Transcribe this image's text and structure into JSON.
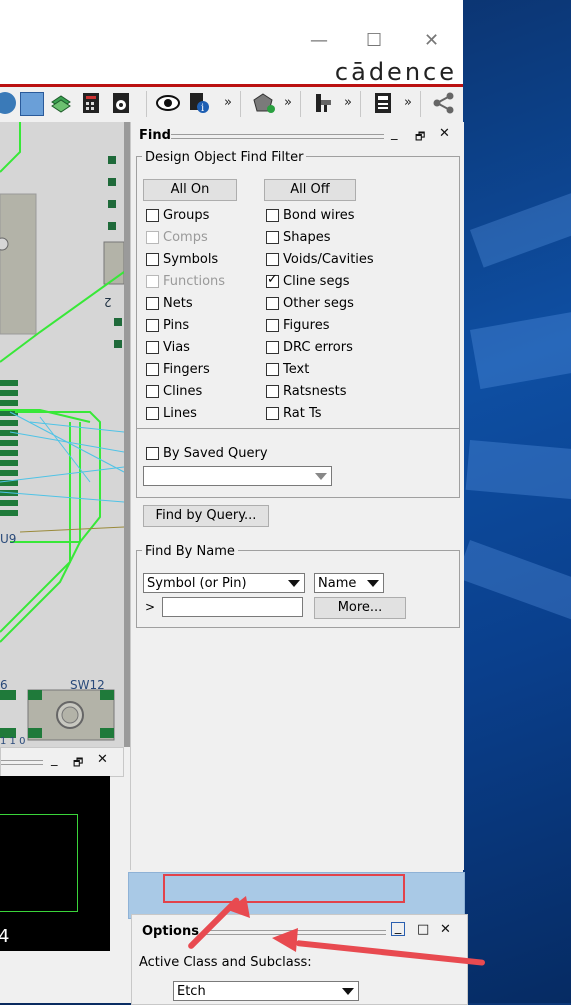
{
  "window": {
    "brand": "cādence",
    "controls": {
      "minimize": "—",
      "maximize": "☐",
      "close": "✕"
    }
  },
  "toolbar": {
    "icons": [
      "view-icon",
      "layers-icon",
      "stack-icon",
      "calc-icon",
      "gear-doc-icon",
      "eye-icon",
      "info-icon",
      "pentagon-icon",
      "probe-icon",
      "memory-icon",
      "share-icon"
    ],
    "overflow": "»"
  },
  "canvas": {
    "labels": {
      "sw_left": "2",
      "u9": "U9",
      "sw6": "6",
      "sw12": "SW12",
      "bottom": "1 1 0"
    }
  },
  "worldview": {
    "controls": {
      "minimize": "_",
      "restore": "🗗",
      "close": "✕"
    },
    "number": "4"
  },
  "find": {
    "title": "Find",
    "controls": {
      "minimize": "_",
      "restore": "🗗",
      "close": "✕"
    },
    "filter_group": "Design Object Find Filter",
    "all_on": "All On",
    "all_off": "All Off",
    "left_items": [
      {
        "label": "Groups",
        "checked": false,
        "enabled": true
      },
      {
        "label": "Comps",
        "checked": false,
        "enabled": false
      },
      {
        "label": "Symbols",
        "checked": false,
        "enabled": true
      },
      {
        "label": "Functions",
        "checked": false,
        "enabled": false
      },
      {
        "label": "Nets",
        "checked": false,
        "enabled": true
      },
      {
        "label": "Pins",
        "checked": false,
        "enabled": true
      },
      {
        "label": "Vias",
        "checked": false,
        "enabled": true
      },
      {
        "label": "Fingers",
        "checked": false,
        "enabled": true
      },
      {
        "label": "Clines",
        "checked": false,
        "enabled": true
      },
      {
        "label": "Lines",
        "checked": false,
        "enabled": true
      }
    ],
    "right_items": [
      {
        "label": "Bond wires",
        "checked": false,
        "enabled": true
      },
      {
        "label": "Shapes",
        "checked": false,
        "enabled": true
      },
      {
        "label": "Voids/Cavities",
        "checked": false,
        "enabled": true
      },
      {
        "label": "Cline segs",
        "checked": true,
        "enabled": true
      },
      {
        "label": "Other segs",
        "checked": false,
        "enabled": true
      },
      {
        "label": "Figures",
        "checked": false,
        "enabled": true
      },
      {
        "label": "DRC errors",
        "checked": false,
        "enabled": true
      },
      {
        "label": "Text",
        "checked": false,
        "enabled": true
      },
      {
        "label": "Ratsnests",
        "checked": false,
        "enabled": true
      },
      {
        "label": "Rat Ts",
        "checked": false,
        "enabled": true
      }
    ],
    "by_saved_query": "By Saved Query",
    "saved_query_value": "",
    "find_by_query": "Find by Query...",
    "find_by_name_group": "Find By Name",
    "type_value": "Symbol (or Pin)",
    "mode_value": "Name",
    "prompt": ">",
    "name_value": "",
    "more": "More..."
  },
  "options": {
    "title": "Options",
    "controls": {
      "minimize": "_",
      "maximize": "□",
      "close": "✕"
    },
    "active_label": "Active Class and Subclass:",
    "class_value": "Etch"
  },
  "colors": {
    "accent_red": "#e2424a",
    "dock_blue": "#a9c9e6",
    "brand_red": "#b11111"
  }
}
